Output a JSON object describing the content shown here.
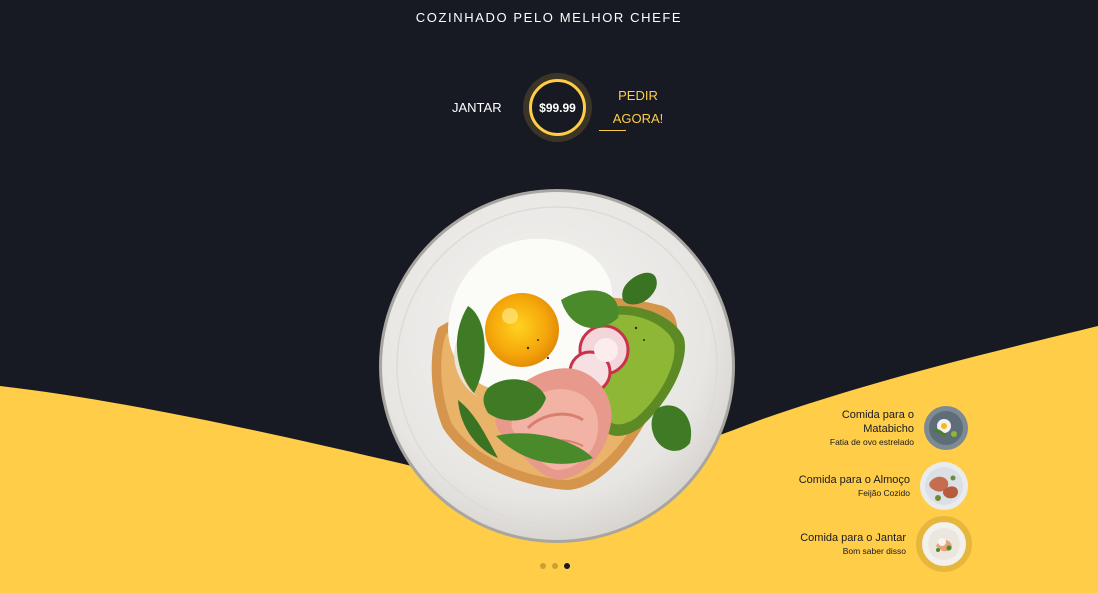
{
  "hero": {
    "tagline": "COZINHADO PELO MELHOR CHEFE",
    "meal_type": "JANTAR",
    "price": "$99.99",
    "order_line1": "PEDIR",
    "order_line2": "AGORA!"
  },
  "menu": [
    {
      "title_line1": "Comida para o",
      "title_line2": "Matabicho",
      "subtitle": "Fatia de ovo estrelado",
      "image": "breakfast-dish-thumbnail",
      "active": false
    },
    {
      "title_line1": "Comida para o Almoço",
      "title_line2": "",
      "subtitle": "Feijão Cozido",
      "image": "lunch-dish-thumbnail",
      "active": false
    },
    {
      "title_line1": "Comida para o Jantar",
      "title_line2": "",
      "subtitle": "Bom saber disso",
      "image": "dinner-dish-thumbnail",
      "active": true
    }
  ],
  "carousel": {
    "count": 3,
    "active_index": 3
  },
  "colors": {
    "background": "#171a23",
    "accent": "#ffcd47",
    "text_light": "#ffffff"
  },
  "main_image": "avocado-toast-with-fried-egg-plate"
}
